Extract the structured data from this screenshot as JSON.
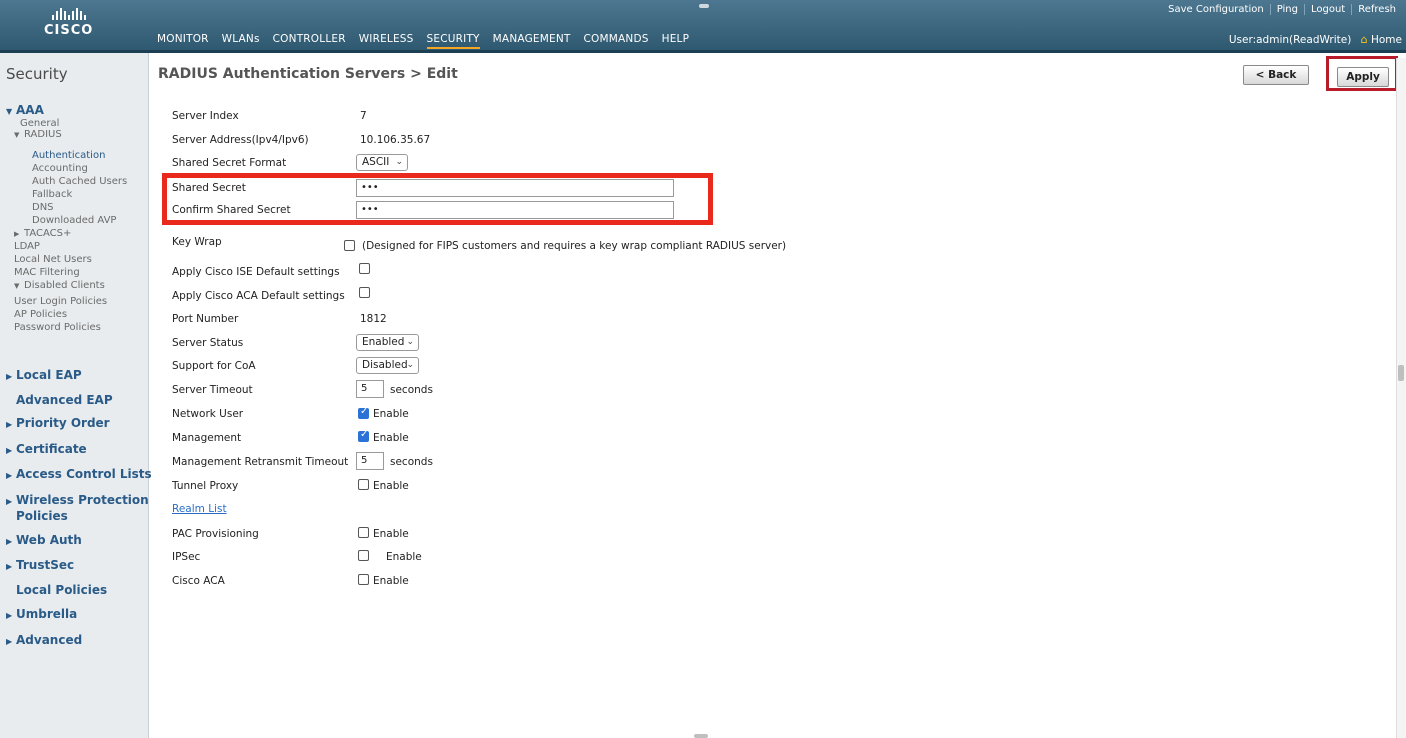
{
  "header": {
    "brand": "CISCO",
    "menu": [
      "MONITOR",
      "WLANs",
      "CONTROLLER",
      "WIRELESS",
      "SECURITY",
      "MANAGEMENT",
      "COMMANDS",
      "HELP"
    ],
    "active_menu": "SECURITY",
    "links": [
      "Save Configuration",
      "Ping",
      "Logout",
      "Refresh"
    ],
    "user": "User:admin(ReadWrite)",
    "home": "Home"
  },
  "sidebar": {
    "title": "Security",
    "aaa": "AAA",
    "general": "General",
    "radius": "RADIUS",
    "authentication": "Authentication",
    "accounting": "Accounting",
    "auth_cached_users": "Auth Cached Users",
    "fallback": "Fallback",
    "dns": "DNS",
    "downloaded_avp": "Downloaded AVP",
    "tacacs": "TACACS+",
    "ldap": "LDAP",
    "local_net_users": "Local Net Users",
    "mac_filtering": "MAC Filtering",
    "disabled_clients": "Disabled Clients",
    "user_login_policies": "User Login Policies",
    "ap_policies": "AP Policies",
    "password_policies": "Password Policies",
    "local_eap": "Local EAP",
    "advanced_eap": "Advanced EAP",
    "priority_order": "Priority Order",
    "certificate": "Certificate",
    "acl": "Access Control Lists",
    "wpp_1": "Wireless Protection",
    "wpp_2": "Policies",
    "web_auth": "Web Auth",
    "trustsec": "TrustSec",
    "local_policies": "Local Policies",
    "umbrella": "Umbrella",
    "advanced": "Advanced"
  },
  "main": {
    "title": "RADIUS Authentication Servers > Edit",
    "back_label": "< Back",
    "apply_label": "Apply",
    "fields": {
      "server_index": {
        "label": "Server Index",
        "value": "7"
      },
      "server_address": {
        "label": "Server Address(Ipv4/Ipv6)",
        "value": "10.106.35.67"
      },
      "secret_format": {
        "label": "Shared Secret Format",
        "value": "ASCII"
      },
      "shared_secret": {
        "label": "Shared Secret",
        "value": "•••"
      },
      "confirm_secret": {
        "label": "Confirm Shared Secret",
        "value": "•••"
      },
      "key_wrap": {
        "label": "Key Wrap",
        "note": "(Designed for FIPS customers and requires a key wrap compliant RADIUS server)",
        "checked": false
      },
      "ise_default": {
        "label": "Apply Cisco ISE Default settings",
        "checked": false
      },
      "aca_default": {
        "label": "Apply Cisco ACA Default settings",
        "checked": false
      },
      "port": {
        "label": "Port Number",
        "value": "1812"
      },
      "server_status": {
        "label": "Server Status",
        "value": "Enabled"
      },
      "coa": {
        "label": "Support for CoA",
        "value": "Disabled"
      },
      "server_timeout": {
        "label": "Server Timeout",
        "value": "5",
        "unit": "seconds"
      },
      "network_user": {
        "label": "Network User",
        "option": "Enable",
        "checked": true
      },
      "management": {
        "label": "Management",
        "option": "Enable",
        "checked": true
      },
      "mgmt_retransmit": {
        "label": "Management Retransmit Timeout",
        "value": "5",
        "unit": "seconds"
      },
      "tunnel_proxy": {
        "label": "Tunnel Proxy",
        "option": "Enable",
        "checked": false
      },
      "realm_list": {
        "label": "Realm List"
      },
      "pac": {
        "label": "PAC Provisioning",
        "option": "Enable",
        "checked": false
      },
      "ipsec": {
        "label": "IPSec",
        "option": "Enable",
        "checked": false
      },
      "cisco_aca": {
        "label": "Cisco ACA",
        "option": "Enable",
        "checked": false
      }
    }
  }
}
